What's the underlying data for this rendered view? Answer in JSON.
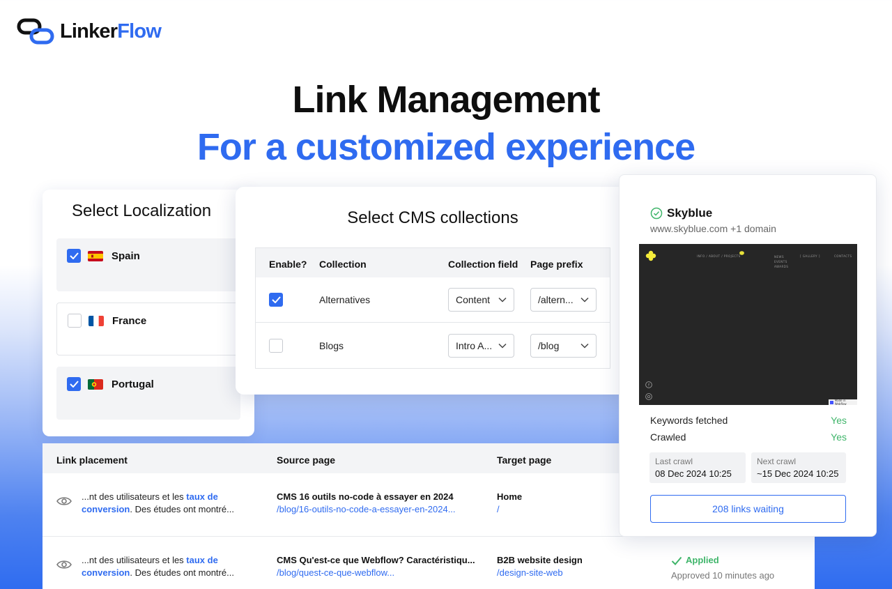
{
  "brand": {
    "name_a": "Linker",
    "name_b": "Flow"
  },
  "hero": {
    "title": "Link Management",
    "subtitle": "For a customized experience"
  },
  "localization": {
    "title": "Select Localization",
    "items": [
      {
        "label": "Spain",
        "checked": true
      },
      {
        "label": "France",
        "checked": false
      },
      {
        "label": "Portugal",
        "checked": true
      }
    ]
  },
  "cms": {
    "title": "Select CMS collections",
    "columns": [
      "Enable?",
      "Collection",
      "Collection field",
      "Page prefix"
    ],
    "rows": [
      {
        "enabled": true,
        "collection": "Alternatives",
        "field": "Content",
        "prefix": "/altern..."
      },
      {
        "enabled": false,
        "collection": "Blogs",
        "field": "Intro A...",
        "prefix": "/blog"
      }
    ]
  },
  "site": {
    "name": "Skyblue",
    "domain": "www.skyblue.com +1 domain",
    "preview": {
      "nav_center": "INFO / ABOUT / PROJECTS",
      "nav_col1": [
        "NEWS",
        "EVENTS",
        "AWARDS"
      ],
      "nav_gallery": "[ GALLERY ]",
      "nav_contacts": "CONTACTS",
      "badge": "Made in Webflow"
    },
    "keywords_label": "Keywords fetched",
    "keywords_value": "Yes",
    "crawled_label": "Crawled",
    "crawled_value": "Yes",
    "last_crawl_label": "Last crawl",
    "last_crawl_value": "08 Dec 2024 10:25",
    "next_crawl_label": "Next crawl",
    "next_crawl_value": "~15 Dec 2024 10:25",
    "links_button": "208 links waiting"
  },
  "links": {
    "columns": [
      "Link placement",
      "Source page",
      "Target page"
    ],
    "rows": [
      {
        "snippet_before": "...nt des utilisateurs et les ",
        "snippet_link": "taux de conversion",
        "snippet_after": ". Des études ont montré...",
        "source_title": "CMS 16 outils no-code à essayer en 2024",
        "source_url": "/blog/16-outils-no-code-a-essayer-en-2024...",
        "target_title": "Home",
        "target_url": "/"
      },
      {
        "snippet_before": "...nt des utilisateurs et les ",
        "snippet_link": "taux de conversion",
        "snippet_after": ". Des études ont montré...",
        "source_title": "CMS Qu'est-ce que Webflow? Caractéristiqu...",
        "source_url": "/blog/quest-ce-que-webflow...",
        "target_title": "B2B website design",
        "target_url": "/design-site-web",
        "status": "Applied",
        "status_sub": "Approved 10 minutes ago"
      }
    ]
  },
  "colors": {
    "brand": "#2f6bf0",
    "success": "#3fb56a"
  }
}
